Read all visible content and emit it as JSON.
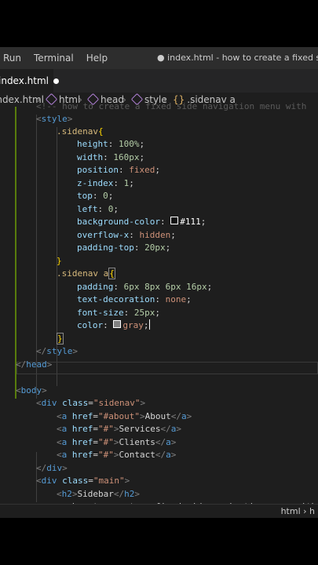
{
  "menubar": {
    "items": [
      "Run",
      "Terminal",
      "Help"
    ],
    "window_title": "● index.html - how to create a fixed side nav"
  },
  "tab": {
    "label": "index.html",
    "modified": true
  },
  "breadcrumb": {
    "file": "index.html",
    "items": [
      "html",
      "head",
      "style",
      ".sidenav a"
    ]
  },
  "editor": {
    "ghost_line": "<!-- how to create a fixed side navigation menu with",
    "css": {
      "selector1": ".sidenav",
      "props1": [
        {
          "name": "height",
          "value": "100%"
        },
        {
          "name": "width",
          "value": "160px"
        },
        {
          "name": "position",
          "value": "fixed"
        },
        {
          "name": "z-index",
          "value": "1"
        },
        {
          "name": "top",
          "value": "0"
        },
        {
          "name": "left",
          "value": "0"
        },
        {
          "name": "background-color",
          "value": "#111"
        },
        {
          "name": "overflow-x",
          "value": "hidden"
        },
        {
          "name": "padding-top",
          "value": "20px"
        }
      ],
      "selector2": ".sidenav a",
      "props2": [
        {
          "name": "padding",
          "value": "6px 8px 6px 16px"
        },
        {
          "name": "text-decoration",
          "value": "none"
        },
        {
          "name": "font-size",
          "value": "25px"
        },
        {
          "name": "color",
          "value": "gray"
        }
      ],
      "swatches": {
        "background-color": "#111111",
        "color": "#808080"
      }
    },
    "html": {
      "div1_class": "sidenav",
      "links": [
        {
          "href": "#about",
          "text": "About"
        },
        {
          "href": "#",
          "text": "Services"
        },
        {
          "href": "#",
          "text": "Clients"
        },
        {
          "href": "#",
          "text": "Contact"
        }
      ],
      "div2_class": "main",
      "h2": "Sidebar",
      "p_text": "how to create a fixed side navigation menu with"
    }
  },
  "statusbar": {
    "text": "html › h"
  },
  "colors": {
    "accent_green": "#587c0c",
    "editor_bg": "#1e1e1e"
  }
}
